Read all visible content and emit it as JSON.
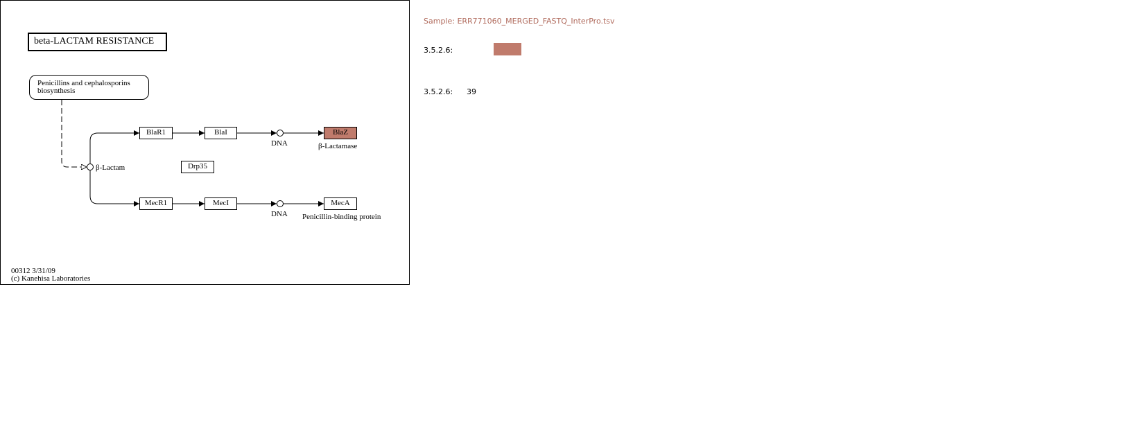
{
  "map": {
    "title": "beta-LACTAM  RESISTANCE",
    "linked_map": {
      "line1": "Penicillins and cephalosporins",
      "line2": "biosynthesis"
    },
    "compound_label": "β-Lactam",
    "dna_label_top": "DNA",
    "dna_label_bottom": "DNA",
    "genes": {
      "blar1": "BlaR1",
      "blai": "BlaI",
      "blaz": "BlaZ",
      "drp35": "Drp35",
      "mecr1": "MecR1",
      "meci": "MecI",
      "meca": "MecA"
    },
    "blaz_caption": "β-Lactamase",
    "meca_caption": "Penicillin-binding protein",
    "footer": {
      "line1": "00312 3/31/09",
      "line2": "(c) Kanehisa Laboratories"
    },
    "highlight_color": "#c07b6c"
  },
  "sidebar": {
    "sample": "Sample: ERR771060_MERGED_FASTQ_InterPro.tsv",
    "ec_row_1": {
      "ec": "3.5.2.6:"
    },
    "ec_row_2": {
      "ec": "3.5.2.6:",
      "count": "39"
    },
    "swatch_color": "#c07b6c"
  }
}
